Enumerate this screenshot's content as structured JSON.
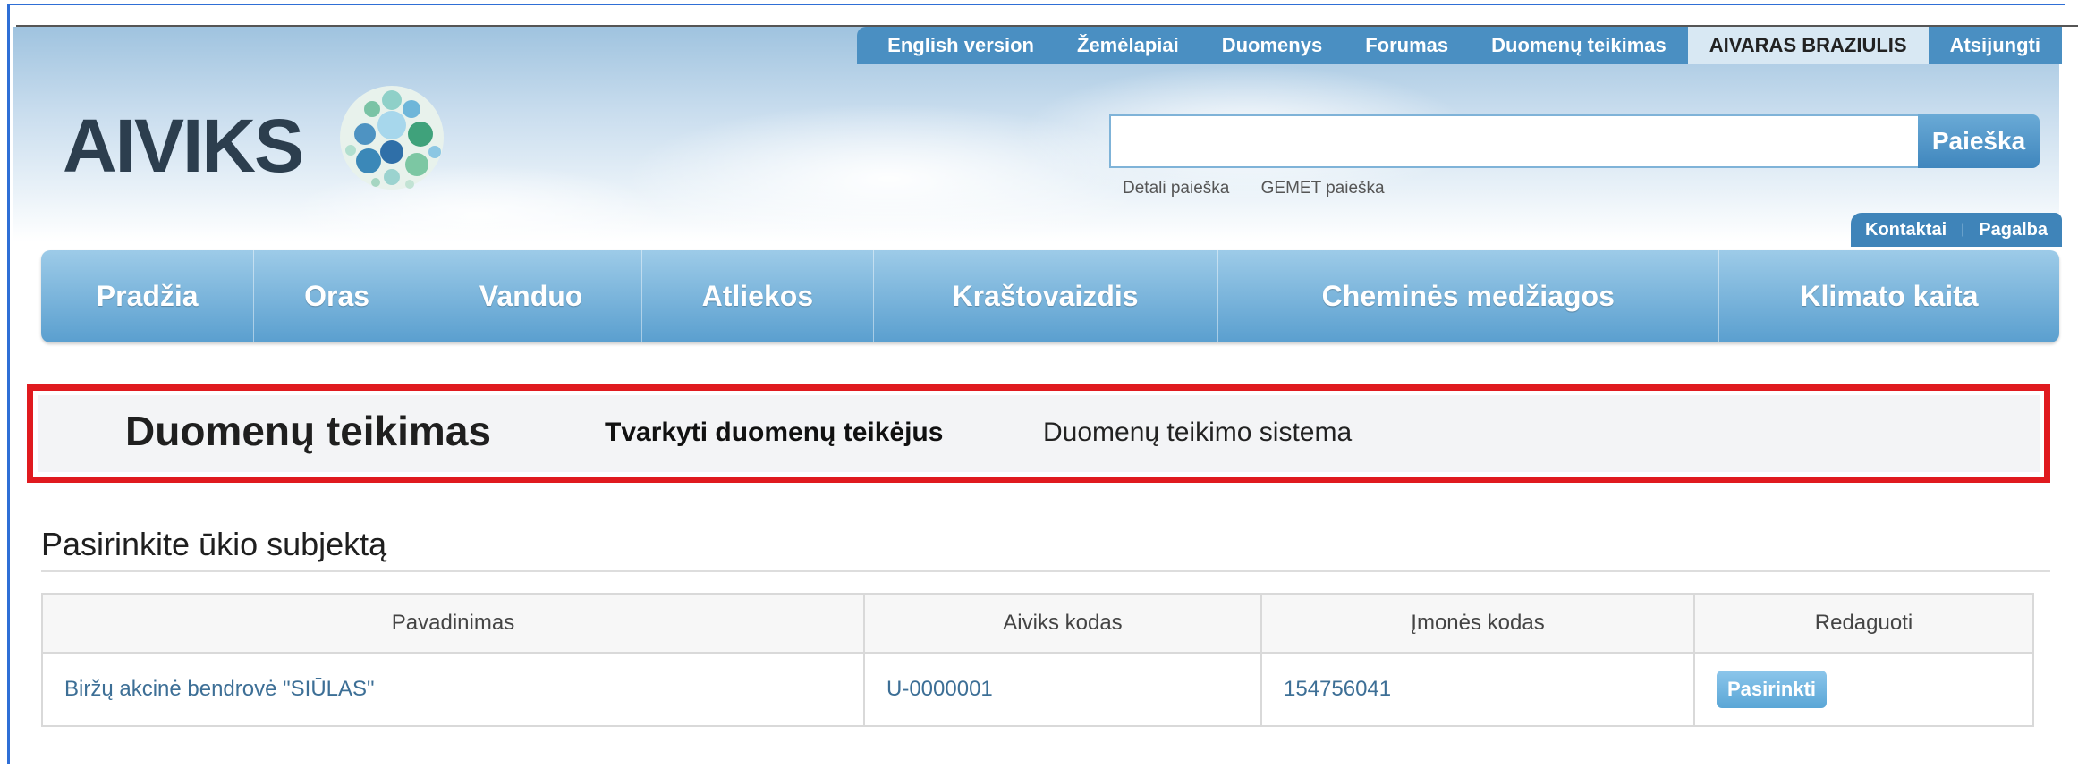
{
  "header": {
    "top_links": [
      "English version",
      "Žemėlapiai",
      "Duomenys",
      "Forumas",
      "Duomenų teikimas"
    ],
    "user_name": "AIVARAS BRAZIULIS",
    "logout": "Atsijungti",
    "logo_text": "AIVIKS",
    "search": {
      "placeholder": "",
      "button": "Paieška"
    },
    "sub_links": [
      "Detali paieška",
      "GEMET paieška"
    ],
    "contacts": "Kontaktai",
    "help": "Pagalba"
  },
  "nav": [
    "Pradžia",
    "Oras",
    "Vanduo",
    "Atliekos",
    "Kraštovaizdis",
    "Cheminės medžiagos",
    "Klimato kaita"
  ],
  "data_provision": {
    "title": "Duomenų teikimas",
    "manage_link": "Tvarkyti duomenų teikėjus",
    "system_link": "Duomenų teikimo sistema"
  },
  "section_title": "Pasirinkite ūkio subjektą",
  "table": {
    "headers": [
      "Pavadinimas",
      "Aiviks kodas",
      "Įmonės kodas",
      "Redaguoti"
    ],
    "rows": [
      {
        "name": "Biržų akcinė bendrovė \"SIŪLAS\"",
        "aiviks_code": "U-0000001",
        "company_code": "154756041",
        "action": "Pasirinkti"
      }
    ]
  },
  "colors": {
    "accent": "#4a8fc2",
    "highlight_border": "#e01a1f"
  }
}
